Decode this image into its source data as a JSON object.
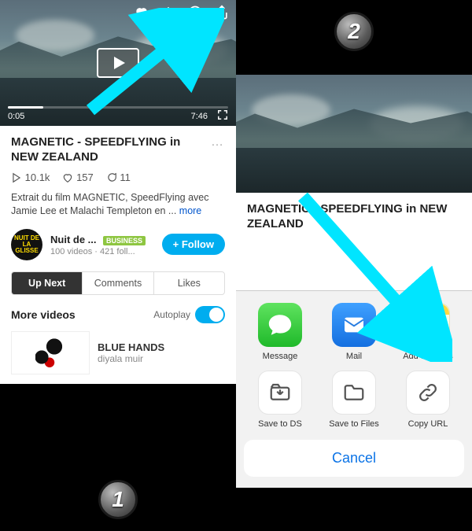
{
  "step1_label": "1",
  "step2_label": "2",
  "video": {
    "title": "MAGNETIC - SPEEDFLYING in NEW ZEALAND",
    "time_current": "0:05",
    "time_total": "7:46",
    "plays": "10.1k",
    "likes": "157",
    "comments": "11",
    "description_text": "Extrait du film MAGNETIC, SpeedFlying avec Jamie Lee et Malachi Templeton en ... ",
    "description_more": "more"
  },
  "channel": {
    "name": "Nuit de ...",
    "badge": "BUSINESS",
    "subtext": "100 videos · 421 foll...",
    "avatar_text": "NUIT DE LA GLISSE",
    "follow_label": "+ Follow"
  },
  "tabs": {
    "upnext": "Up Next",
    "comments": "Comments",
    "likes": "Likes"
  },
  "more_section": {
    "label": "More videos",
    "autoplay_label": "Autoplay"
  },
  "next_video": {
    "title": "BLUE HANDS",
    "author": "diyala muir"
  },
  "share": {
    "message": "Message",
    "mail": "Mail",
    "notes": "Add to Notes",
    "save_ds": "Save to DS",
    "save_files": "Save to Files",
    "copy_url": "Copy URL",
    "cancel": "Cancel"
  }
}
